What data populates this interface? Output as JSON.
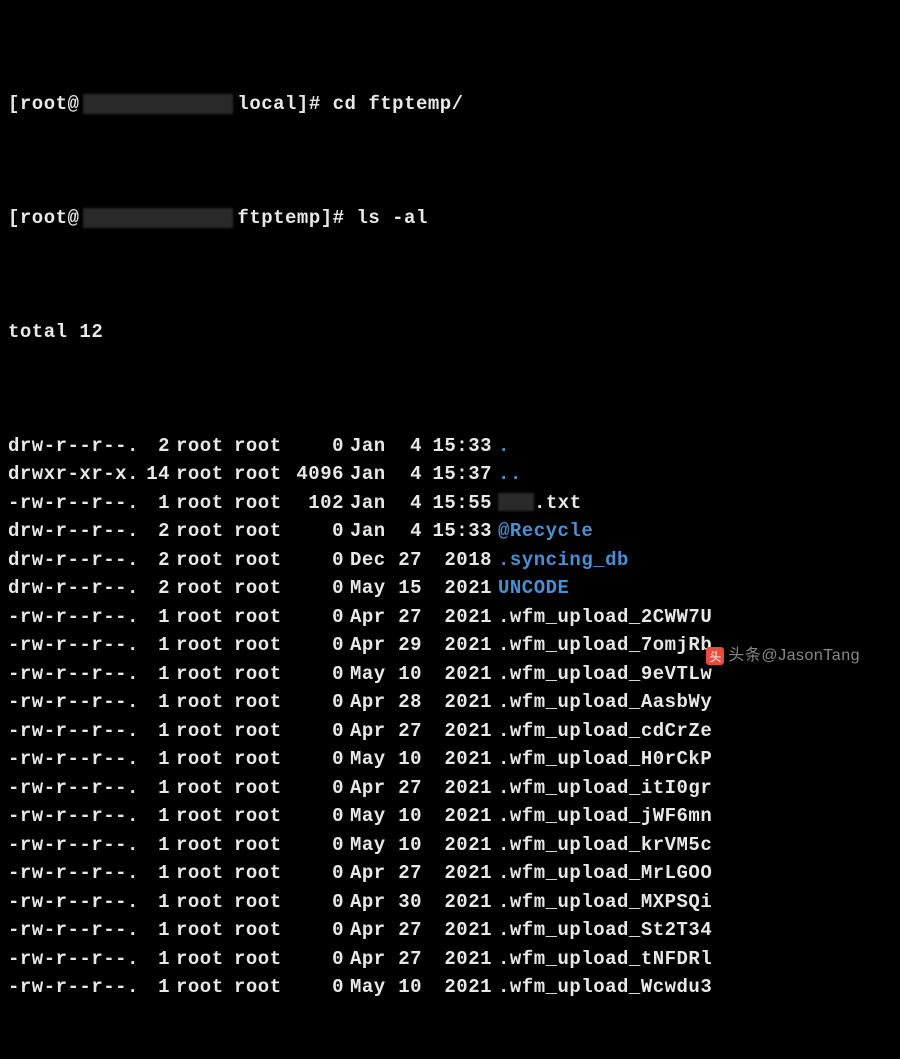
{
  "prompt1": {
    "user_host_prefix": "[root@",
    "cwd": "local]#",
    "command": "cd ftptemp/"
  },
  "prompt2": {
    "user_host_prefix": "[root@",
    "cwd": "ftptemp]#",
    "command": "ls -al"
  },
  "total_line": "total 12",
  "files": [
    {
      "perms": "drw-r--r--.",
      "links": "2",
      "owner": "root",
      "group": "root",
      "size": "0",
      "month": "Jan",
      "day": "4",
      "time": "15:33",
      "name": ".",
      "type": "dir"
    },
    {
      "perms": "drwxr-xr-x.",
      "links": "14",
      "owner": "root",
      "group": "root",
      "size": "4096",
      "month": "Jan",
      "day": "4",
      "time": "15:37",
      "name": "..",
      "type": "dir"
    },
    {
      "perms": "-rw-r--r--.",
      "links": "1",
      "owner": "root",
      "group": "root",
      "size": "102",
      "month": "Jan",
      "day": "4",
      "time": "15:55",
      "name": "txt",
      "type": "file",
      "redacted_prefix": true
    },
    {
      "perms": "drw-r--r--.",
      "links": "2",
      "owner": "root",
      "group": "root",
      "size": "0",
      "month": "Jan",
      "day": "4",
      "time": "15:33",
      "name": "@Recycle",
      "type": "dir"
    },
    {
      "perms": "drw-r--r--.",
      "links": "2",
      "owner": "root",
      "group": "root",
      "size": "0",
      "month": "Dec",
      "day": "27",
      "time": "2018",
      "name": ".syncing_db",
      "type": "dir"
    },
    {
      "perms": "drw-r--r--.",
      "links": "2",
      "owner": "root",
      "group": "root",
      "size": "0",
      "month": "May",
      "day": "15",
      "time": "2021",
      "name": "UNCODE",
      "type": "dir"
    },
    {
      "perms": "-rw-r--r--.",
      "links": "1",
      "owner": "root",
      "group": "root",
      "size": "0",
      "month": "Apr",
      "day": "27",
      "time": "2021",
      "name": ".wfm_upload_2CWW7U",
      "type": "file"
    },
    {
      "perms": "-rw-r--r--.",
      "links": "1",
      "owner": "root",
      "group": "root",
      "size": "0",
      "month": "Apr",
      "day": "29",
      "time": "2021",
      "name": ".wfm_upload_7omjRb",
      "type": "file"
    },
    {
      "perms": "-rw-r--r--.",
      "links": "1",
      "owner": "root",
      "group": "root",
      "size": "0",
      "month": "May",
      "day": "10",
      "time": "2021",
      "name": ".wfm_upload_9eVTLw",
      "type": "file"
    },
    {
      "perms": "-rw-r--r--.",
      "links": "1",
      "owner": "root",
      "group": "root",
      "size": "0",
      "month": "Apr",
      "day": "28",
      "time": "2021",
      "name": ".wfm_upload_AasbWy",
      "type": "file"
    },
    {
      "perms": "-rw-r--r--.",
      "links": "1",
      "owner": "root",
      "group": "root",
      "size": "0",
      "month": "Apr",
      "day": "27",
      "time": "2021",
      "name": ".wfm_upload_cdCrZe",
      "type": "file"
    },
    {
      "perms": "-rw-r--r--.",
      "links": "1",
      "owner": "root",
      "group": "root",
      "size": "0",
      "month": "May",
      "day": "10",
      "time": "2021",
      "name": ".wfm_upload_H0rCkP",
      "type": "file"
    },
    {
      "perms": "-rw-r--r--.",
      "links": "1",
      "owner": "root",
      "group": "root",
      "size": "0",
      "month": "Apr",
      "day": "27",
      "time": "2021",
      "name": ".wfm_upload_itI0gr",
      "type": "file"
    },
    {
      "perms": "-rw-r--r--.",
      "links": "1",
      "owner": "root",
      "group": "root",
      "size": "0",
      "month": "May",
      "day": "10",
      "time": "2021",
      "name": ".wfm_upload_jWF6mn",
      "type": "file"
    },
    {
      "perms": "-rw-r--r--.",
      "links": "1",
      "owner": "root",
      "group": "root",
      "size": "0",
      "month": "May",
      "day": "10",
      "time": "2021",
      "name": ".wfm_upload_krVM5c",
      "type": "file"
    },
    {
      "perms": "-rw-r--r--.",
      "links": "1",
      "owner": "root",
      "group": "root",
      "size": "0",
      "month": "Apr",
      "day": "27",
      "time": "2021",
      "name": ".wfm_upload_MrLGOO",
      "type": "file"
    },
    {
      "perms": "-rw-r--r--.",
      "links": "1",
      "owner": "root",
      "group": "root",
      "size": "0",
      "month": "Apr",
      "day": "30",
      "time": "2021",
      "name": ".wfm_upload_MXPSQi",
      "type": "file"
    },
    {
      "perms": "-rw-r--r--.",
      "links": "1",
      "owner": "root",
      "group": "root",
      "size": "0",
      "month": "Apr",
      "day": "27",
      "time": "2021",
      "name": ".wfm_upload_St2T34",
      "type": "file"
    },
    {
      "perms": "-rw-r--r--.",
      "links": "1",
      "owner": "root",
      "group": "root",
      "size": "0",
      "month": "Apr",
      "day": "27",
      "time": "2021",
      "name": ".wfm_upload_tNFDRl",
      "type": "file"
    },
    {
      "perms": "-rw-r--r--.",
      "links": "1",
      "owner": "root",
      "group": "root",
      "size": "0",
      "month": "May",
      "day": "10",
      "time": "2021",
      "name": ".wfm_upload_Wcwdu3",
      "type": "file"
    }
  ],
  "watermark": "头条@JasonTang"
}
